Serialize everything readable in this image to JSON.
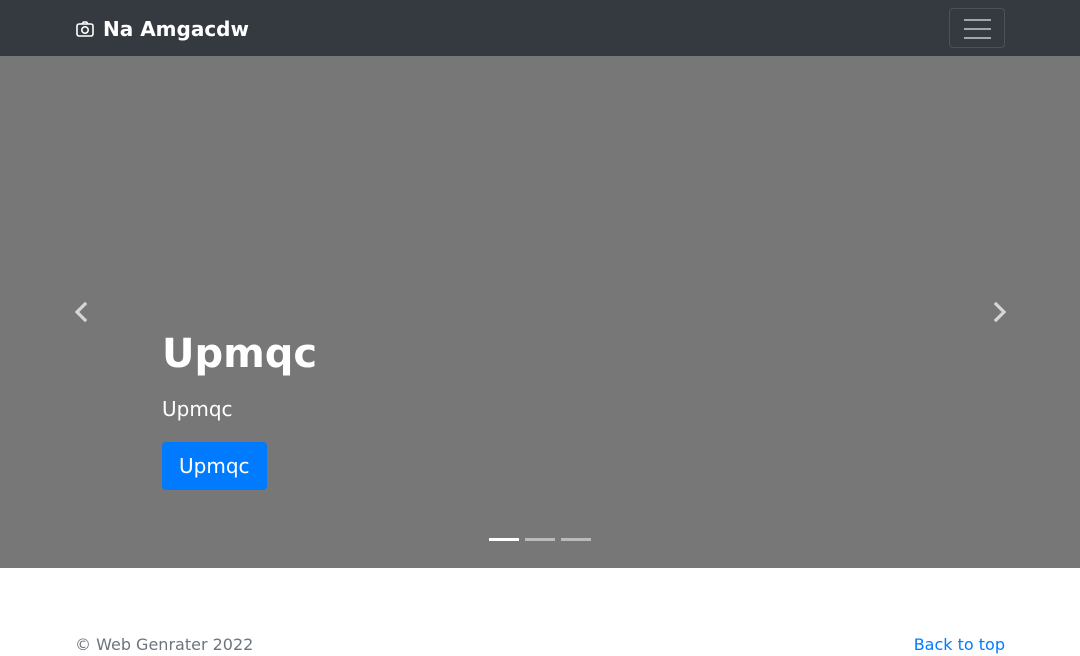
{
  "navbar": {
    "brand_icon": "camera-icon",
    "brand_text": "Na Amgacdw",
    "toggler_icon": "hamburger-menu-icon",
    "background": "#343a40"
  },
  "carousel": {
    "background": "#777777",
    "prev_icon": "chevron-left-icon",
    "next_icon": "chevron-right-icon",
    "slide": {
      "heading": "Upmqc",
      "subtext": "Upmqc",
      "button_label": "Upmqc",
      "button_color": "#007bff"
    },
    "indicators": [
      {
        "active": true
      },
      {
        "active": false
      },
      {
        "active": false
      }
    ]
  },
  "footer": {
    "copyright": "© Web Genrater 2022",
    "back_to_top": "Back to top",
    "link_color": "#007bff"
  }
}
